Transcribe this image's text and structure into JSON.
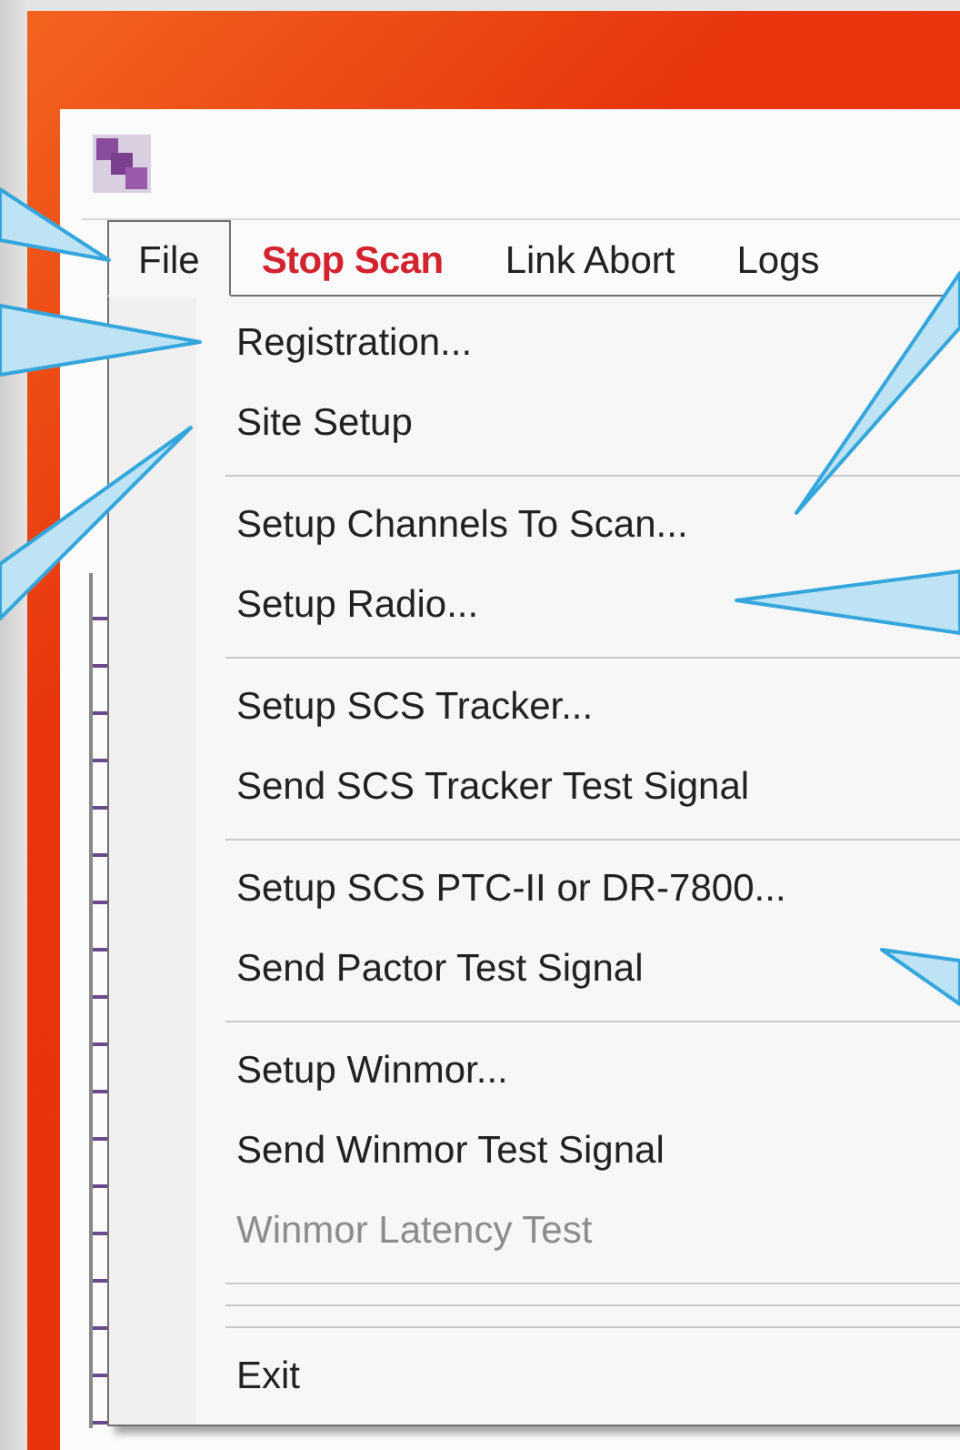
{
  "menu_bar": [
    {
      "label": "File",
      "selected": true,
      "alert": false
    },
    {
      "label": "Stop Scan",
      "selected": false,
      "alert": true
    },
    {
      "label": "Link Abort",
      "selected": false,
      "alert": false
    },
    {
      "label": "Logs",
      "selected": false,
      "alert": false
    }
  ],
  "file_menu": [
    {
      "kind": "item",
      "label": "Registration...",
      "disabled": false
    },
    {
      "kind": "item",
      "label": "Site Setup",
      "disabled": false
    },
    {
      "kind": "separator"
    },
    {
      "kind": "item",
      "label": "Setup Channels To Scan...",
      "disabled": false
    },
    {
      "kind": "item",
      "label": "Setup Radio...",
      "disabled": false
    },
    {
      "kind": "separator"
    },
    {
      "kind": "item",
      "label": "Setup SCS Tracker...",
      "disabled": false
    },
    {
      "kind": "item",
      "label": "Send SCS Tracker Test Signal",
      "disabled": false
    },
    {
      "kind": "separator"
    },
    {
      "kind": "item",
      "label": "Setup SCS PTC-II or DR-7800...",
      "disabled": false
    },
    {
      "kind": "item",
      "label": "Send Pactor Test Signal",
      "disabled": false
    },
    {
      "kind": "separator"
    },
    {
      "kind": "item",
      "label": "Setup Winmor...",
      "disabled": false
    },
    {
      "kind": "item",
      "label": "Send Winmor Test Signal",
      "disabled": false
    },
    {
      "kind": "item",
      "label": "Winmor Latency Test",
      "disabled": true
    },
    {
      "kind": "separator"
    },
    {
      "kind": "separator"
    },
    {
      "kind": "separator"
    },
    {
      "kind": "item",
      "label": "Exit",
      "disabled": false
    }
  ]
}
